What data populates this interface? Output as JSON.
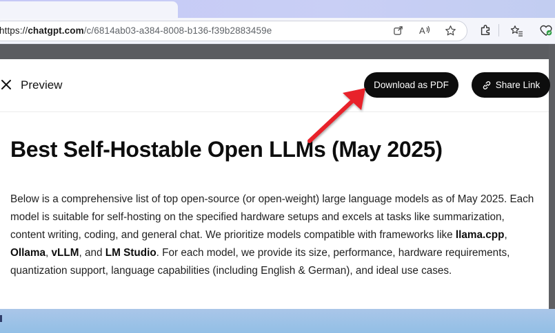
{
  "browser": {
    "url_prefix": "https://",
    "url_host": "chatgpt.com",
    "url_path": "/c/6814ab03-a384-8008-b136-f39b2883459e",
    "icons": [
      "open-in-app-icon",
      "read-aloud-icon",
      "favorite-star-icon",
      "extensions-icon",
      "favorites-list-icon",
      "browser-essentials-icon"
    ]
  },
  "preview": {
    "header_title": "Preview",
    "close_icon": "close-icon",
    "download_label": "Download as PDF",
    "share_label": "Share Link",
    "share_icon": "link-icon"
  },
  "document": {
    "title": "Best Self-Hostable Open LLMs (May 2025)",
    "intro_1": "Below is a comprehensive list of top open-source (or open-weight) large language models as of May 2025. Each model is suitable for self-hosting on the specified hardware setups and excels at tasks like summarization, content writing, coding, and general chat. We prioritize models compatible with frameworks like ",
    "fw_1": "llama.cpp",
    "sep_1": ", ",
    "fw_2": "Ollama",
    "sep_2": ", ",
    "fw_3": "vLLM",
    "sep_3": ", and ",
    "fw_4": "LM Studio",
    "intro_2": ". For each model, we provide its size, performance, hardware requirements, quantization support, language capabilities (including English & German), and ideal use cases."
  },
  "annotation": {
    "arrow_color": "#e8202a",
    "target": "Download as PDF"
  },
  "colors": {
    "button_bg": "#0d0d0d",
    "button_text": "#ffffff",
    "panel_bg": "#ffffff"
  }
}
